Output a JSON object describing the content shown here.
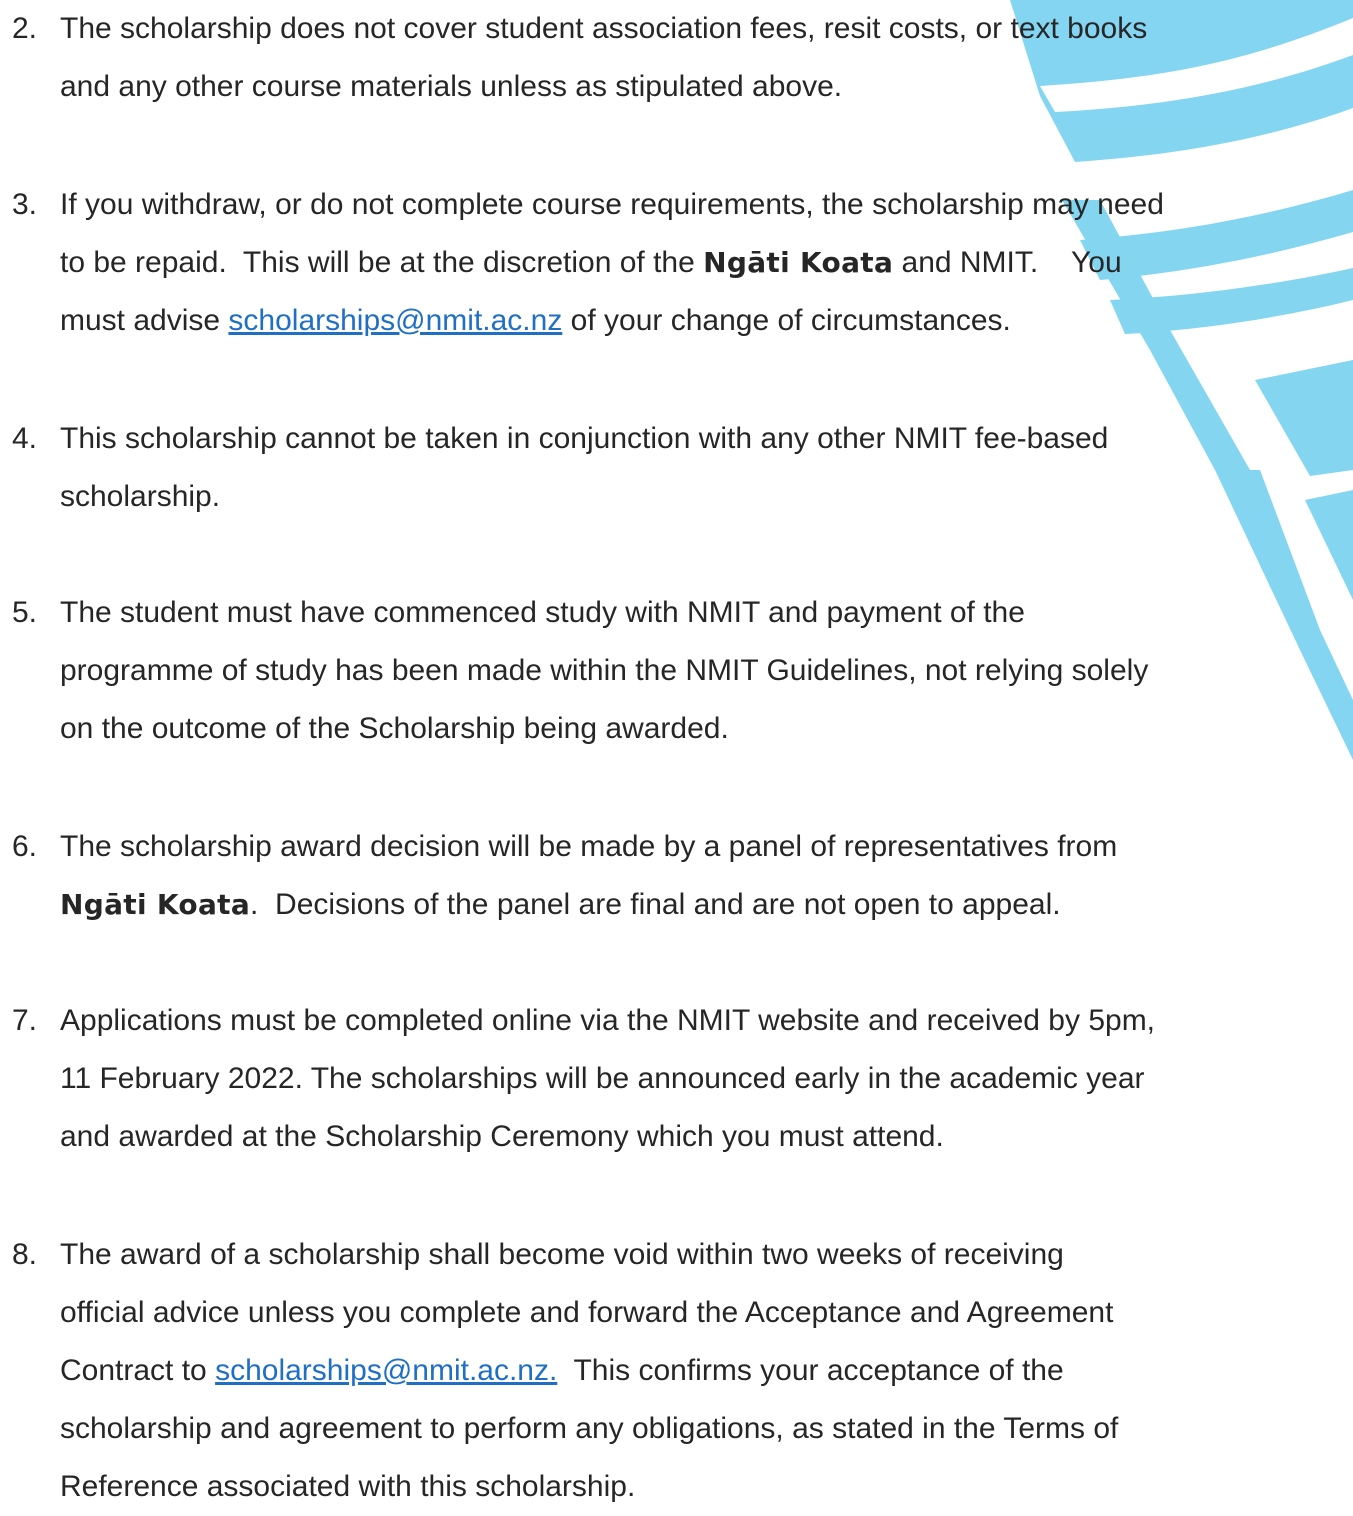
{
  "watermark": {
    "color": "#7dd3f0",
    "name": "institution-logo-watermark"
  },
  "items": [
    {
      "number": "2.",
      "lines": [
        [
          {
            "t": "The scholarship does not cover student association fees, resit costs, or text books"
          }
        ],
        [
          {
            "t": "and any other course materials unless as stipulated above."
          }
        ]
      ]
    },
    {
      "number": "3.",
      "lines": [
        [
          {
            "t": "If you withdraw, or do not complete course requirements, the scholarship may need"
          }
        ],
        [
          {
            "t": "to be repaid.  This will be at the discretion of the "
          },
          {
            "t": "Ngāti Koata",
            "s": "brand"
          },
          {
            "t": " and NMIT.    You"
          }
        ],
        [
          {
            "t": "must advise "
          },
          {
            "t": "scholarships@nmit.ac.nz",
            "s": "link"
          },
          {
            "t": " of your change of circumstances."
          }
        ]
      ]
    },
    {
      "number": "4.",
      "lines": [
        [
          {
            "t": "This scholarship cannot be taken in conjunction with any other NMIT fee-based"
          }
        ],
        [
          {
            "t": "scholarship."
          }
        ]
      ]
    },
    {
      "number": "5.",
      "lines": [
        [
          {
            "t": "The student must have commenced study with NMIT and payment of the"
          }
        ],
        [
          {
            "t": "programme of study has been made within the NMIT Guidelines, not relying solely"
          }
        ],
        [
          {
            "t": "on the outcome of the Scholarship being awarded."
          }
        ]
      ]
    },
    {
      "number": "6.",
      "lines": [
        [
          {
            "t": "The scholarship award decision will be made by a panel of representatives from"
          }
        ],
        [
          {
            "t": "Ngāti Koata",
            "s": "brand"
          },
          {
            "t": ".  Decisions of the panel are final and are not open to appeal."
          }
        ]
      ]
    },
    {
      "number": "7.",
      "lines": [
        [
          {
            "t": "Applications must be completed online via the NMIT website and received by 5pm,"
          }
        ],
        [
          {
            "t": "11 February 2022. The scholarships will be announced early in the academic year"
          }
        ],
        [
          {
            "t": "and awarded at the Scholarship Ceremony which you must attend."
          }
        ]
      ]
    },
    {
      "number": "8.",
      "lines": [
        [
          {
            "t": "The award of a scholarship shall become void within two weeks of receiving"
          }
        ],
        [
          {
            "t": "official advice unless you complete and forward the Acceptance and Agreement"
          }
        ],
        [
          {
            "t": "Contract to "
          },
          {
            "t": "scholarships@nmit.ac.nz.",
            "s": "link"
          },
          {
            "t": "  This confirms your acceptance of the"
          }
        ],
        [
          {
            "t": "scholarship and agreement to perform any obligations, as stated in the Terms of"
          }
        ],
        [
          {
            "t": "Reference associated with this scholarship."
          }
        ]
      ]
    }
  ]
}
